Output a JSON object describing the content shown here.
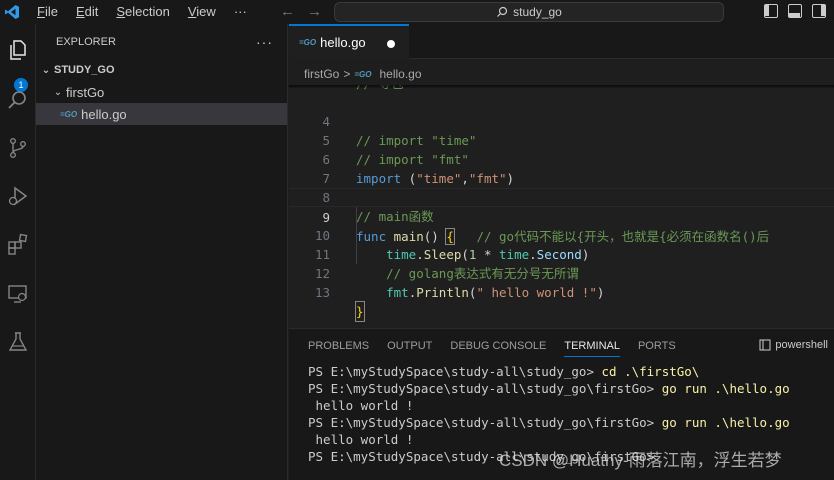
{
  "menu": [
    {
      "key": "F",
      "rest": "ile"
    },
    {
      "key": "E",
      "rest": "dit"
    },
    {
      "key": "S",
      "rest": "election"
    },
    {
      "key": "V",
      "rest": "iew"
    }
  ],
  "command_center": {
    "text": "study_go"
  },
  "activity_badge": "1",
  "sidebar": {
    "title": "EXPLORER",
    "more": "···",
    "workspace": "STUDY_GO",
    "folder": "firstGo",
    "file": "hello.go"
  },
  "tab": {
    "label": "hello.go"
  },
  "breadcrumb": {
    "folder": "firstGo",
    "separator": ">",
    "file": "hello.go"
  },
  "code": {
    "line_numbers": [
      "4",
      "5",
      "6",
      "7",
      "8",
      "9",
      "10",
      "11",
      "12",
      "13"
    ],
    "line4": "// import \"time\"",
    "line5": "// import \"fmt\"",
    "line6": {
      "kw": "import",
      "open": " (",
      "s1": "\"time\"",
      "comma": ",",
      "s2": "\"fmt\"",
      "close": ")"
    },
    "line8": "// main函数",
    "line9": {
      "kw": "func",
      "fn": "main",
      "parens": "()",
      "brace": "{",
      "comment": "// go代码不能以{开头，也就是{必须在函数名()后"
    },
    "line10": {
      "pkg": "time",
      "fn": "Sleep",
      "open": "(",
      "num": "1",
      "op": " * ",
      "pkg2": "time",
      "field": "Second",
      "close": ")"
    },
    "line11": "// golang表达式有无分号无所谓",
    "line12": {
      "pkg": "fmt",
      "fn": "Println",
      "open": "(",
      "str": "\" hello world !\"",
      "close": ")"
    },
    "line13": "}"
  },
  "panel": {
    "tabs": [
      "PROBLEMS",
      "OUTPUT",
      "DEBUG CONSOLE",
      "TERMINAL",
      "PORTS"
    ],
    "active_tab": "TERMINAL",
    "shell": "powershell"
  },
  "terminal": [
    {
      "prompt": "PS E:\\myStudySpace\\study-all\\study_go> ",
      "cmd": "cd .\\firstGo\\"
    },
    {
      "prompt": "PS E:\\myStudySpace\\study-all\\study_go\\firstGo> ",
      "cmd": "go run .\\hello.go"
    },
    {
      "output": " hello world !"
    },
    {
      "prompt": "PS E:\\myStudySpace\\study-all\\study_go\\firstGo> ",
      "cmd": "go run .\\hello.go"
    },
    {
      "output": " hello world !"
    },
    {
      "prompt": "PS E:\\myStudySpace\\study-all\\study_go\\firstGo> ",
      "cmd": ""
    }
  ],
  "watermark": "CSDN @Huathy-雨落江南，浮生若梦",
  "colors": {
    "accent": "#0078d4",
    "editor_bg": "#1f1f1f",
    "sidebar_bg": "#181818"
  }
}
